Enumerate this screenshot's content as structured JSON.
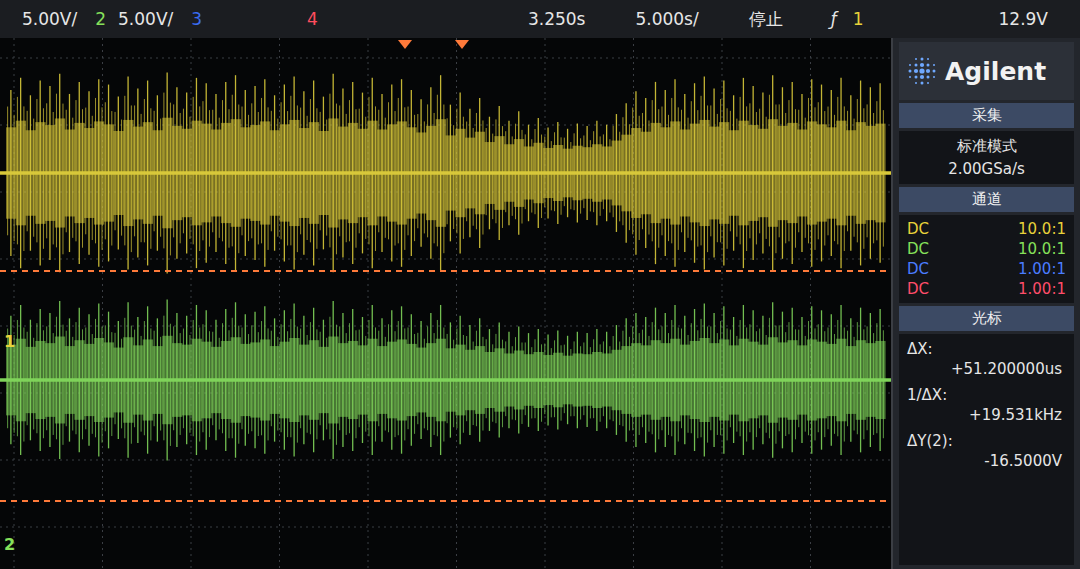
{
  "top_bar": {
    "ch1_scale": "5.00V/",
    "ch2_label": "2",
    "ch2_scale": "5.00V/",
    "ch3_label": "3",
    "ch4_label": "4",
    "delay": "3.250s",
    "timebase": "5.000s/",
    "run_state": "停止",
    "trigger_icon": "ƒ",
    "trigger_source": "1",
    "trigger_level": "12.9V"
  },
  "logo": {
    "text": "Agilent"
  },
  "acquire": {
    "title": "采集",
    "mode": "标准模式",
    "rate": "2.00GSa/s"
  },
  "channels": {
    "title": "通道",
    "items": [
      {
        "coupling": "DC",
        "probe": "10.0:1",
        "color": "#e8d23a"
      },
      {
        "coupling": "DC",
        "probe": "10.0:1",
        "color": "#86e05a"
      },
      {
        "coupling": "DC",
        "probe": "1.00:1",
        "color": "#4a7cff"
      },
      {
        "coupling": "DC",
        "probe": "1.00:1",
        "color": "#ff4d6a"
      }
    ]
  },
  "cursors": {
    "title": "光标",
    "items": [
      {
        "label": "ΔX:",
        "value": "+51.200000us"
      },
      {
        "label": "1/ΔX:",
        "value": "+19.531kHz"
      },
      {
        "label": "ΔY(2):",
        "value": "-16.5000V"
      }
    ]
  },
  "chart": {
    "markers": [
      {
        "label": "1",
        "color": "#e8d23a"
      },
      {
        "label": "2",
        "color": "#86e05a"
      }
    ],
    "series": [
      {
        "color": "#d8c83a",
        "values": [
          6.2,
          7.1,
          5.8,
          6.9,
          6.5,
          7.4,
          5.9,
          6.8,
          6.1,
          7.0,
          6.6,
          5.7,
          7.2,
          6.3,
          6.9,
          5.8,
          7.5,
          6.4,
          6.0,
          7.1,
          6.7,
          5.9,
          6.8,
          7.3,
          6.2,
          6.5,
          7.0,
          5.8,
          6.6,
          7.2,
          6.1,
          6.9,
          5.7,
          7.4,
          6.3,
          6.8,
          6.0,
          7.1,
          5.9,
          6.6,
          7.0,
          6.2,
          5.5,
          6.4,
          7.3,
          5.1,
          6.0,
          4.8,
          5.6,
          4.2,
          5.0,
          3.9,
          4.6,
          3.6,
          4.1,
          3.4,
          3.8,
          3.3,
          3.7,
          3.5,
          3.9,
          3.6,
          4.4,
          5.2,
          6.1,
          5.6,
          6.8,
          6.2,
          7.0,
          5.9,
          6.7,
          7.2,
          6.3,
          6.9,
          5.8,
          7.1,
          6.5,
          6.0,
          7.3,
          6.4,
          6.8,
          5.9,
          7.0,
          6.6,
          6.2,
          7.1,
          5.8,
          6.9,
          6.4,
          6.7
        ]
      },
      {
        "color": "#7fd35a",
        "values": [
          4.8,
          5.6,
          4.5,
          5.3,
          5.0,
          5.9,
          4.6,
          5.4,
          4.9,
          5.7,
          5.1,
          4.4,
          5.8,
          4.7,
          5.5,
          4.6,
          6.0,
          5.0,
          4.8,
          5.6,
          5.2,
          4.5,
          5.3,
          5.8,
          4.9,
          5.1,
          5.5,
          4.6,
          5.2,
          5.7,
          4.8,
          5.4,
          4.5,
          5.9,
          5.0,
          5.3,
          4.7,
          5.6,
          4.6,
          5.2,
          5.5,
          4.9,
          4.4,
          5.0,
          5.6,
          4.3,
          4.8,
          4.1,
          4.6,
          3.8,
          4.3,
          3.6,
          4.0,
          3.5,
          3.8,
          3.4,
          3.7,
          3.3,
          3.6,
          3.5,
          3.8,
          3.6,
          4.1,
          4.6,
          5.0,
          4.7,
          5.4,
          5.0,
          5.6,
          4.8,
          5.3,
          5.7,
          5.0,
          5.5,
          4.7,
          5.6,
          5.2,
          4.8,
          5.8,
          5.1,
          5.4,
          4.7,
          5.5,
          5.2,
          4.9,
          5.6,
          4.6,
          5.4,
          5.0,
          5.3
        ]
      }
    ]
  }
}
